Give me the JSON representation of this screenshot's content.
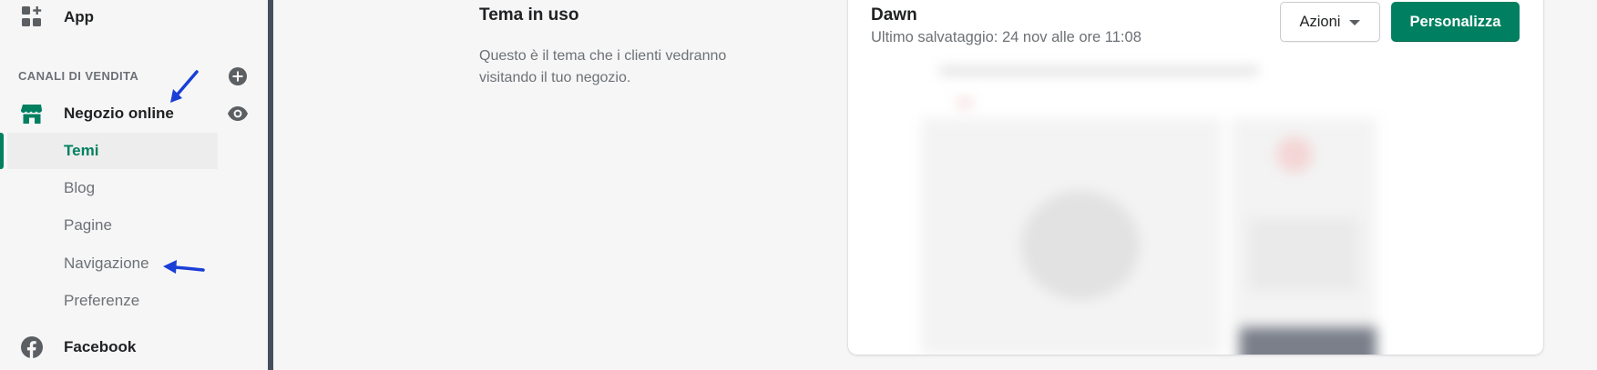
{
  "sidebar": {
    "app_label": "App",
    "sales_channels_title": "CANALI DI VENDITA",
    "online_store_label": "Negozio online",
    "sub_items": [
      {
        "label": "Temi",
        "active": true
      },
      {
        "label": "Blog",
        "active": false
      },
      {
        "label": "Pagine",
        "active": false
      },
      {
        "label": "Navigazione",
        "active": false
      },
      {
        "label": "Preferenze",
        "active": false
      }
    ],
    "facebook_label": "Facebook"
  },
  "main": {
    "section_title": "Tema in uso",
    "section_description": "Questo è il tema che i clienti vedranno visitando il tuo negozio.",
    "theme": {
      "name": "Dawn",
      "last_saved": "Ultimo salvataggio: 24 nov alle ore 11:08",
      "actions_label": "Azioni",
      "customize_label": "Personalizza"
    }
  },
  "colors": {
    "accent": "#008060",
    "annotation_arrow": "#1a3fd6",
    "divider": "#454f5b"
  },
  "icons": {
    "app": "apps-grid-icon",
    "add": "plus-circle-icon",
    "store": "storefront-icon",
    "view": "eye-icon",
    "facebook": "facebook-icon",
    "dropdown": "caret-down-icon"
  }
}
